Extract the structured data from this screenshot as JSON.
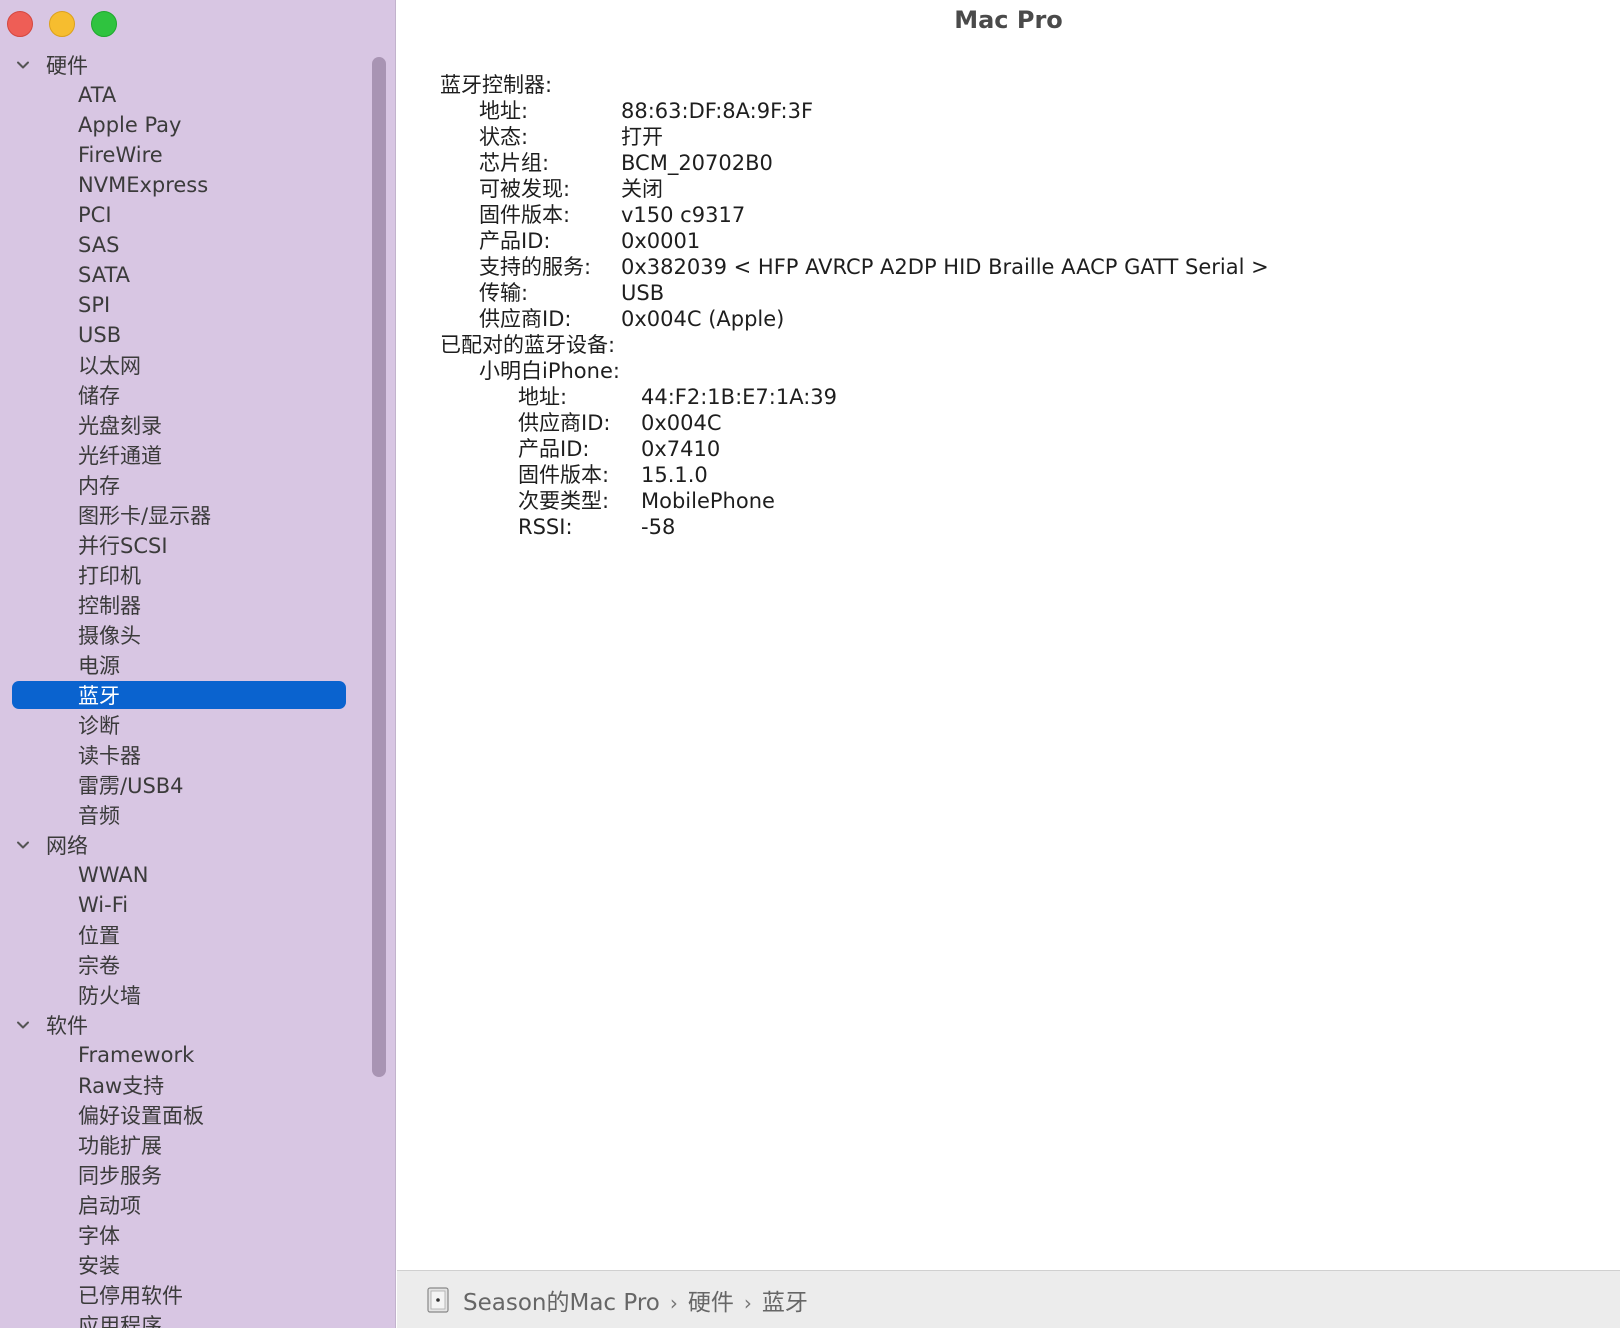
{
  "window": {
    "title": "Mac Pro"
  },
  "sidebar": {
    "groups": [
      {
        "label": "硬件",
        "items": [
          "ATA",
          "Apple Pay",
          "FireWire",
          "NVMExpress",
          "PCI",
          "SAS",
          "SATA",
          "SPI",
          "USB",
          "以太网",
          "储存",
          "光盘刻录",
          "光纤通道",
          "内存",
          "图形卡/显示器",
          "并行SCSI",
          "打印机",
          "控制器",
          "摄像头",
          "电源",
          "蓝牙",
          "诊断",
          "读卡器",
          "雷雳/USB4",
          "音频"
        ]
      },
      {
        "label": "网络",
        "items": [
          "WWAN",
          "Wi-Fi",
          "位置",
          "宗卷",
          "防火墙"
        ]
      },
      {
        "label": "软件",
        "items": [
          "Framework",
          "Raw支持",
          "偏好设置面板",
          "功能扩展",
          "同步服务",
          "启动项",
          "字体",
          "安装",
          "已停用软件",
          "应用程序"
        ]
      }
    ],
    "selected": "蓝牙"
  },
  "details": {
    "controller_header": "蓝牙控制器:",
    "controller": [
      {
        "key": "地址:",
        "value": "88:63:DF:8A:9F:3F"
      },
      {
        "key": "状态:",
        "value": "打开"
      },
      {
        "key": "芯片组:",
        "value": "BCM_20702B0"
      },
      {
        "key": "可被发现:",
        "value": "关闭"
      },
      {
        "key": "固件版本:",
        "value": "v150 c9317"
      },
      {
        "key": "产品ID:",
        "value": "0x0001"
      },
      {
        "key": "支持的服务:",
        "value": "0x382039 < HFP AVRCP A2DP HID Braille AACP GATT Serial >"
      },
      {
        "key": "传输:",
        "value": "USB"
      },
      {
        "key": "供应商ID:",
        "value": "0x004C (Apple)"
      }
    ],
    "paired_header": "已配对的蓝牙设备:",
    "device_name": "小明白iPhone:",
    "device": [
      {
        "key": "地址:",
        "value": "44:F2:1B:E7:1A:39"
      },
      {
        "key": "供应商ID:",
        "value": "0x004C"
      },
      {
        "key": "产品ID:",
        "value": "0x7410"
      },
      {
        "key": "固件版本:",
        "value": "15.1.0"
      },
      {
        "key": "次要类型:",
        "value": "MobilePhone"
      },
      {
        "key": "RSSI:",
        "value": "-58"
      }
    ]
  },
  "footer": {
    "crumbs": [
      "Season的Mac Pro",
      "硬件",
      "蓝牙"
    ],
    "separator": "›",
    "icon": "mac-pro-icon"
  }
}
